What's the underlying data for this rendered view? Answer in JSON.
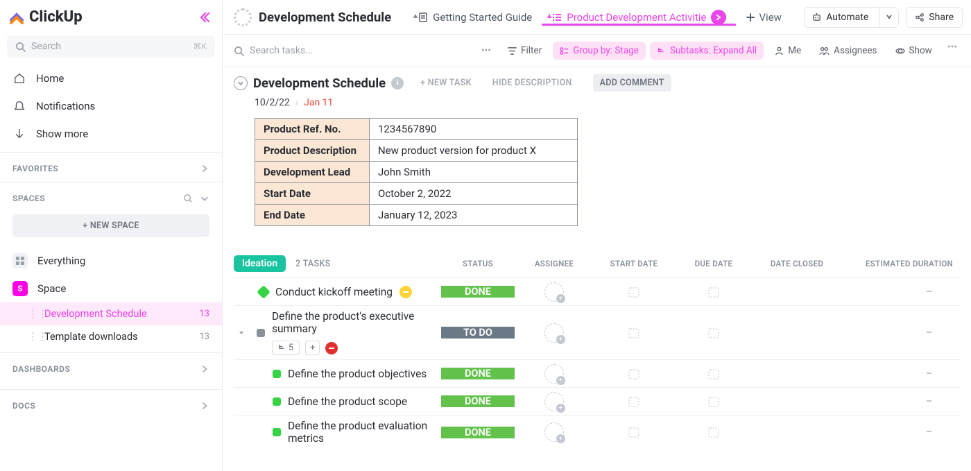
{
  "brand": "ClickUp",
  "sidebar": {
    "search_placeholder": "Search",
    "search_shortcut": "⌘K",
    "nav": [
      {
        "label": "Home"
      },
      {
        "label": "Notifications"
      },
      {
        "label": "Show more"
      }
    ],
    "favorites_title": "FAVORITES",
    "spaces_title": "SPACES",
    "new_space": "+  NEW SPACE",
    "everything": "Everything",
    "space_name": "Space",
    "space_initial": "S",
    "lists": [
      {
        "label": "Development Schedule",
        "count": "13",
        "active": true
      },
      {
        "label": "Template downloads",
        "count": "13",
        "active": false
      }
    ],
    "dashboards": "DASHBOARDS",
    "docs": "DOCS"
  },
  "topbar": {
    "title": "Development Schedule",
    "tabs": [
      {
        "label": "Getting Started Guide",
        "kind": "doc"
      },
      {
        "label": "Product Development Activitie",
        "kind": "list",
        "active": true
      }
    ],
    "view": "View",
    "automate": "Automate",
    "share": "Share"
  },
  "toolbar": {
    "search_placeholder": "Search tasks...",
    "filter": "Filter",
    "group_by": "Group by: Stage",
    "subtasks": "Subtasks: Expand All",
    "me": "Me",
    "assignees": "Assignees",
    "show": "Show"
  },
  "page": {
    "title": "Development Schedule",
    "new_task": "+ NEW TASK",
    "hide_desc": "HIDE DESCRIPTION",
    "add_comment": "ADD COMMENT",
    "start_date": "10/2/22",
    "due_date": "Jan 11"
  },
  "info_table": [
    {
      "key": "Product Ref. No.",
      "val": "1234567890"
    },
    {
      "key": "Product Description",
      "val": "New product version for product X"
    },
    {
      "key": "Development Lead",
      "val": "John Smith"
    },
    {
      "key": "Start Date",
      "val": "October 2, 2022"
    },
    {
      "key": "End Date",
      "val": "January 12, 2023"
    }
  ],
  "group": {
    "name": "Ideation",
    "count": "2 TASKS",
    "columns": {
      "status": "STATUS",
      "assignee": "ASSIGNEE",
      "start": "START DATE",
      "due": "DUE DATE",
      "closed": "DATE CLOSED",
      "dur": "ESTIMATED DURATION"
    }
  },
  "tasks": [
    {
      "title": "Conduct kickoff meeting",
      "status": "DONE",
      "status_kind": "done",
      "bullet": "green",
      "diamond": true,
      "chip": "yellow"
    },
    {
      "title": "Define the product's executive summary",
      "status": "TO DO",
      "status_kind": "todo",
      "bullet": "gray",
      "diamond": false,
      "subcount": "5",
      "tall": true,
      "expand": true
    },
    {
      "title": "Define the product objectives",
      "status": "DONE",
      "status_kind": "done",
      "bullet": "green",
      "sub": true
    },
    {
      "title": "Define the product scope",
      "status": "DONE",
      "status_kind": "done",
      "bullet": "green",
      "sub": true
    },
    {
      "title": "Define the product evaluation metrics",
      "status": "DONE",
      "status_kind": "done",
      "bullet": "green",
      "sub": true
    }
  ],
  "dash": "–"
}
